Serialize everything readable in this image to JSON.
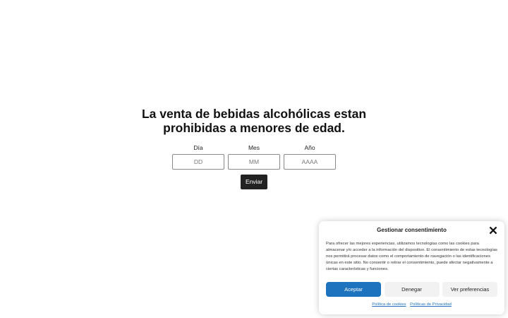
{
  "age_gate": {
    "title": "La venta de bebidas alcohólicas estan prohibidas a menores de edad.",
    "fields": [
      {
        "label": "Día",
        "placeholder": "DD",
        "value": ""
      },
      {
        "label": "Mes",
        "placeholder": "MM",
        "value": ""
      },
      {
        "label": "Año",
        "placeholder": "AAAA",
        "value": ""
      }
    ],
    "submit_label": "Enviar"
  },
  "consent": {
    "title": "Gestionar consentimiento",
    "close_icon": "close-icon",
    "text": "Para ofrecer las mejores experiencias, utilizamos tecnologías como las cookies para almacenar y/o acceder a la información del dispositivo. El consentimiento de estas tecnologías nos permitirá procesar datos como el comportamiento de navegación o las identificaciones únicas en este sitio. No consentir o retirar el consentimiento, puede afectar negativamente a ciertas características y funciones.",
    "buttons": {
      "accept": "Aceptar",
      "deny": "Denegar",
      "preferences": "Ver preferencias"
    },
    "links": {
      "cookies": "Política de cookies",
      "privacy": "Políticas de Privacidad"
    },
    "colors": {
      "accent": "#1e73be",
      "secondary_bg": "#f2f2f2"
    }
  }
}
